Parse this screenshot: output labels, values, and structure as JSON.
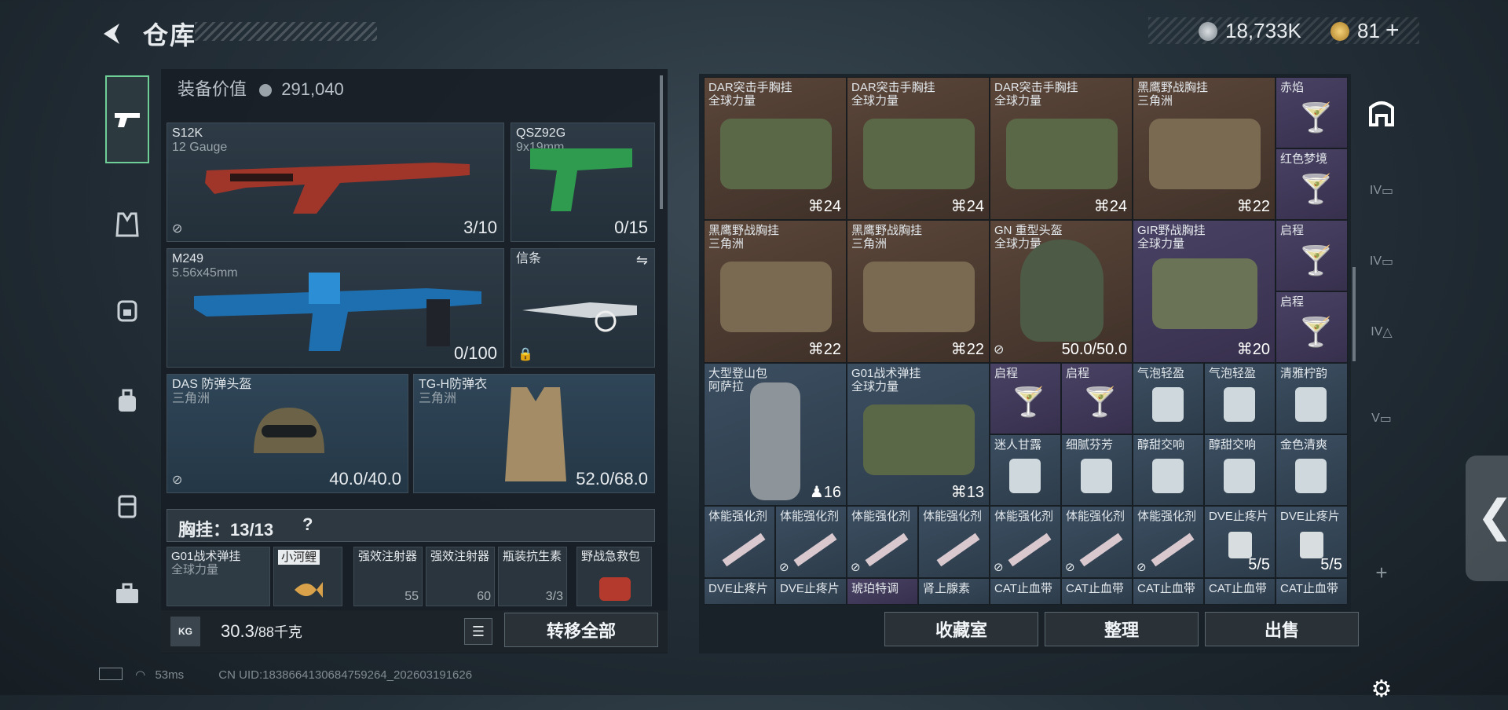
{
  "header": {
    "title": "仓库",
    "currency1": "18,733K",
    "currency2": "81",
    "plus": "+"
  },
  "left": {
    "equip_value_label": "装备价值",
    "equip_value": "291,040",
    "slots": [
      {
        "name": "S12K",
        "sub": "12 Gauge",
        "count": "3/10"
      },
      {
        "name": "QSZ92G",
        "sub": "9x19mm",
        "count": "0/15"
      },
      {
        "name": "M249",
        "sub": "5.56x45mm",
        "count": "0/100"
      },
      {
        "name": "信条",
        "sub": "",
        "count": ""
      },
      {
        "name": "DAS 防弹头盔",
        "sub": "三角洲",
        "count": "40.0/40.0"
      },
      {
        "name": "TG-H防弹衣",
        "sub": "三角洲",
        "count": "52.0/68.0"
      }
    ],
    "chest_label": "胸挂：13/13",
    "chest_help": "?",
    "mini": [
      {
        "name": "G01战术弹挂",
        "sub": "全球力量"
      },
      {
        "name": "小河鲤",
        "sub": "",
        "count": ""
      },
      {
        "name": "强效注射器",
        "count": "55"
      },
      {
        "name": "强效注射器",
        "count": "60"
      },
      {
        "name": "瓶装抗生素",
        "count": "3/3"
      },
      {
        "name": "野战急救包",
        "count": ""
      }
    ],
    "weight": "30.3",
    "weight_max": "/88千克",
    "transfer_all": "转移全部"
  },
  "right": {
    "rows": [
      [
        {
          "name": "DAR突击手胸挂",
          "sub": "全球力量",
          "q": "24",
          "c": "brown"
        },
        {
          "name": "DAR突击手胸挂",
          "sub": "全球力量",
          "q": "24",
          "c": "brown"
        },
        {
          "name": "DAR突击手胸挂",
          "sub": "全球力量",
          "q": "24",
          "c": "brown"
        },
        {
          "name": "黑鹰野战胸挂",
          "sub": "三角洲",
          "q": "22",
          "c": "brown"
        }
      ],
      [
        {
          "name": "黑鹰野战胸挂",
          "sub": "三角洲",
          "q": "22",
          "c": "brown"
        },
        {
          "name": "黑鹰野战胸挂",
          "sub": "三角洲",
          "q": "22",
          "c": "brown"
        },
        {
          "name": "GN 重型头盔",
          "sub": "全球力量",
          "q": "50.0/50.0",
          "c": "brown"
        },
        {
          "name": "GIR野战胸挂",
          "sub": "全球力量",
          "q": "20",
          "c": "purple"
        }
      ]
    ],
    "side_small": [
      "赤焰",
      "红色梦境",
      "启程",
      "启程"
    ],
    "big_row3": [
      {
        "name": "大型登山包",
        "sub": "阿萨拉",
        "q": "16"
      },
      {
        "name": "G01战术弹挂",
        "sub": "全球力量",
        "q": "13"
      }
    ],
    "drinks_row1": [
      "启程",
      "启程",
      "气泡轻盈",
      "气泡轻盈",
      "清雅柠韵"
    ],
    "drinks_row2": [
      "迷人甘露",
      "细腻芬芳",
      "醇甜交响",
      "醇甜交响",
      "金色清爽"
    ],
    "meds_row": [
      "体能强化剂",
      "体能强化剂",
      "体能强化剂",
      "体能强化剂",
      "体能强化剂",
      "体能强化剂",
      "体能强化剂",
      "DVE止疼片",
      "DVE止疼片"
    ],
    "meds_counts": [
      "5/5",
      "5/5"
    ],
    "last_row": [
      "DVE止疼片",
      "DVE止疼片",
      "琥珀特调",
      "肾上腺素",
      "CAT止血带",
      "CAT止血带",
      "CAT止血带",
      "CAT止血带",
      "CAT止血带"
    ],
    "btn_collection": "收藏室",
    "btn_sort": "整理",
    "btn_sell": "出售"
  },
  "side_tabs": [
    "IV",
    "IV",
    "IV",
    "V",
    "+"
  ],
  "status": {
    "ping": "53ms",
    "uid": "CN UID:1838664130684759264_202603191626"
  }
}
